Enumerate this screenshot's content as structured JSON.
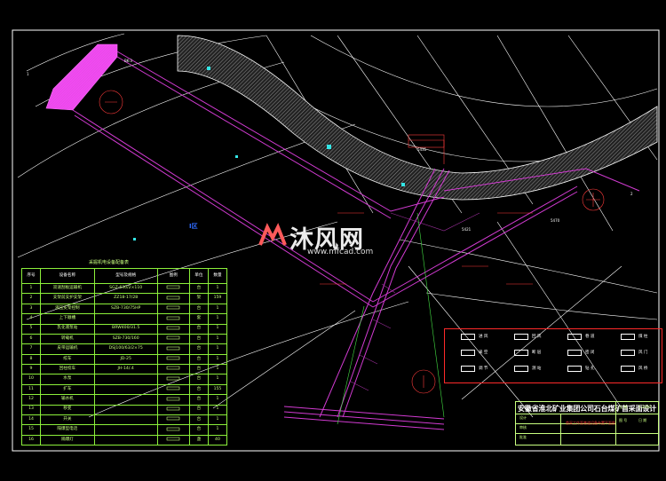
{
  "colors": {
    "background": "#000000",
    "frame": "#ffffff",
    "contour": "#ffffff",
    "tunnel": "#d23bd2",
    "hatch": "#e05ae0",
    "table_text": "#c8ff80",
    "legend_border": "#ff2a2a",
    "annotation_red": "#ff3b3b",
    "marker_cyan": "#33e6e6",
    "marker_blue": "#2f6bff"
  },
  "watermark": {
    "brand": "沐风网",
    "url": "www.mfcad.com",
    "logo_icon": "mf-logo-icon"
  },
  "blue_label": "I区",
  "equipment_table": {
    "caption": "采掘机电设备配备表",
    "headers": [
      "序号",
      "设备名称",
      "型号及规格",
      "图例",
      "单位",
      "数量"
    ],
    "rows": [
      [
        "1",
        "双速刮板运输机",
        "SGZ-630/2×110",
        "",
        "台",
        "1"
      ],
      [
        "2",
        "支架前支护支架",
        "ZZ18-17/28",
        "",
        "架",
        "159"
      ],
      [
        "3",
        "液压支架控制",
        "SZB-730/75HP",
        "",
        "台",
        "1"
      ],
      [
        "4",
        "上下顺槽",
        "",
        "",
        "套",
        "1"
      ],
      [
        "5",
        "乳化液泵站",
        "BRW400/31.5",
        "",
        "台",
        "1"
      ],
      [
        "6",
        "转载机",
        "SZB-730/160",
        "",
        "台",
        "1"
      ],
      [
        "7",
        "皮带运输机",
        "DSJ100/63/2×75",
        "",
        "台",
        "1"
      ],
      [
        "8",
        "绞车",
        "JD-25",
        "",
        "台",
        "1"
      ],
      [
        "9",
        "回柱绞车",
        "JH-14/.4",
        "",
        "台",
        "1"
      ],
      [
        "10",
        "水泵",
        "",
        "",
        "台",
        "1"
      ],
      [
        "11",
        "扩车",
        "",
        "",
        "台",
        "155"
      ],
      [
        "12",
        "输水机",
        "",
        "",
        "台",
        "1"
      ],
      [
        "13",
        "移变",
        "",
        "",
        "台",
        "1"
      ],
      [
        "14",
        "开关",
        "",
        "",
        "台",
        "1"
      ],
      [
        "15",
        "隔爆型电话",
        "",
        "",
        "台",
        "1"
      ],
      [
        "16",
        "隔爆灯",
        "",
        "",
        "盏",
        "40"
      ]
    ]
  },
  "title_block": {
    "title": "安徽省淮北矿业集团公司石台煤矿首采面设计",
    "subtitle": "首采工作面巷道设备布置平面图",
    "rows": [
      "设计",
      "审核",
      "批准"
    ],
    "right_cells": [
      "比 例",
      "1:2000",
      "图 号",
      "日 期"
    ]
  },
  "legend": {
    "items": [
      {
        "symbol": "arrow",
        "label": "进 风"
      },
      {
        "symbol": "dotted-arrow",
        "label": "回 风"
      },
      {
        "symbol": "square",
        "label": "巷 道"
      },
      {
        "symbol": "rect",
        "label": "煤 柱"
      },
      {
        "symbol": "x-rect",
        "label": "采 空"
      },
      {
        "symbol": "hatch",
        "label": "断 层"
      },
      {
        "symbol": "line",
        "label": "密 闭"
      },
      {
        "symbol": "bar",
        "label": "风 门"
      },
      {
        "symbol": "cross",
        "label": "调 节"
      },
      {
        "symbol": "line2",
        "label": "测 站"
      },
      {
        "symbol": "t",
        "label": "钻 孔"
      },
      {
        "symbol": "box",
        "label": "风 桥"
      }
    ]
  }
}
